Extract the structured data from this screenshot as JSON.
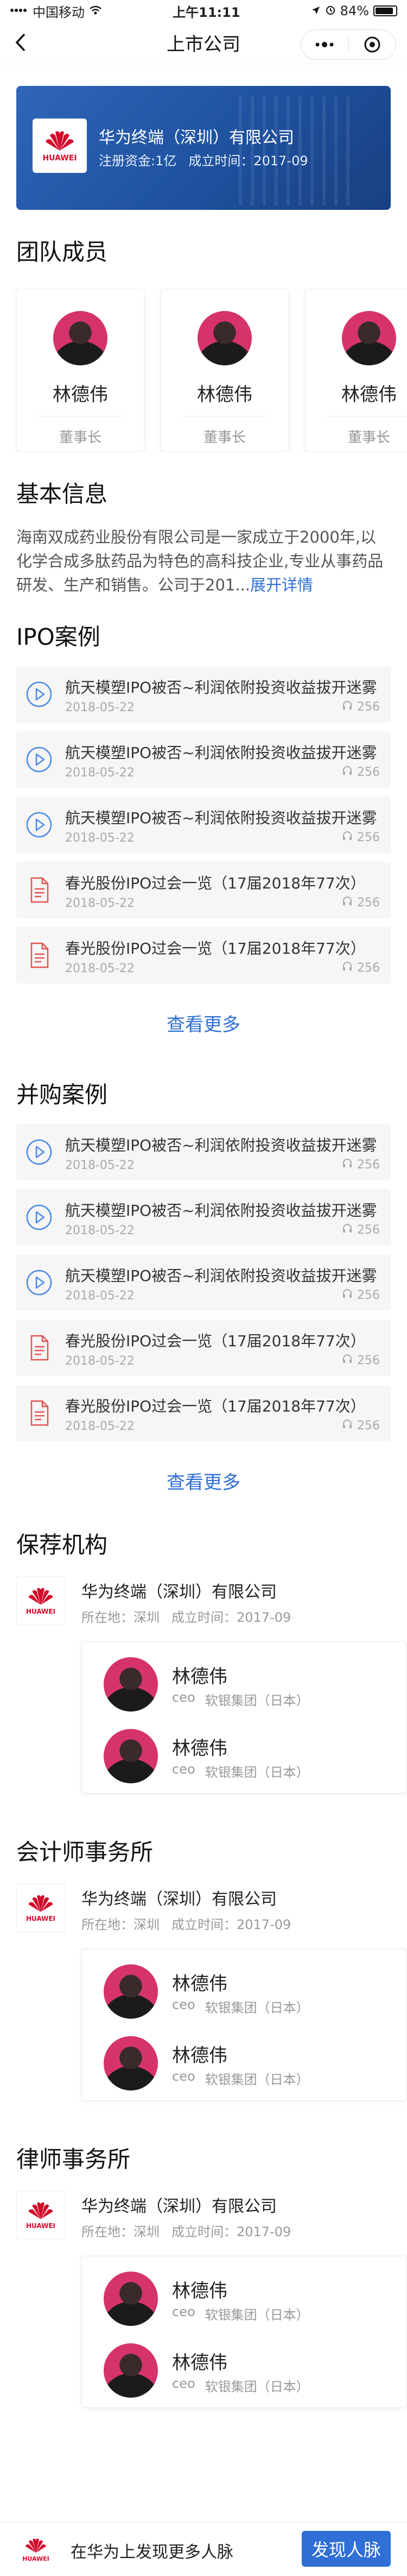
{
  "status_bar": {
    "carrier": "中国移动",
    "time": "上午11:11",
    "battery": "84%"
  },
  "nav": {
    "title": "上市公司"
  },
  "company": {
    "name": "华为终端（深圳）有限公司",
    "capital": "注册资金:1亿",
    "founded": "成立时间：2017-09",
    "logo_text": "HUAWEI"
  },
  "team": {
    "title": "团队成员",
    "members": [
      {
        "name": "林德伟",
        "role": "董事长"
      },
      {
        "name": "林德伟",
        "role": "董事长"
      },
      {
        "name": "林德伟",
        "role": "董事长"
      }
    ]
  },
  "about": {
    "title": "基本信息",
    "text": "海南双成药业股份有限公司是一家成立于2000年,以化学合成多肽药品为特色的高科技企业,专业从事药品研发、生产和销售。公司于201...",
    "more": "展开详情"
  },
  "ipo": {
    "title": "IPO案例",
    "items": [
      {
        "icon": "play-icon",
        "title": "航天模塑IPO被否~利润依附投资收益拔开迷雾",
        "date": "2018-05-22",
        "count": "256"
      },
      {
        "icon": "play-icon",
        "title": "航天模塑IPO被否~利润依附投资收益拔开迷雾",
        "date": "2018-05-22",
        "count": "256"
      },
      {
        "icon": "play-icon",
        "title": "航天模塑IPO被否~利润依附投资收益拔开迷雾",
        "date": "2018-05-22",
        "count": "256"
      },
      {
        "icon": "document-icon",
        "title": "春光股份IPO过会一览（17届2018年77次）",
        "date": "2018-05-22",
        "count": "256"
      },
      {
        "icon": "document-icon",
        "title": "春光股份IPO过会一览（17届2018年77次）",
        "date": "2018-05-22",
        "count": "256"
      }
    ],
    "more": "查看更多"
  },
  "merger": {
    "title": "并购案例",
    "items": [
      {
        "icon": "play-icon",
        "title": "航天模塑IPO被否~利润依附投资收益拔开迷雾",
        "date": "2018-05-22",
        "count": "256"
      },
      {
        "icon": "play-icon",
        "title": "航天模塑IPO被否~利润依附投资收益拔开迷雾",
        "date": "2018-05-22",
        "count": "256"
      },
      {
        "icon": "play-icon",
        "title": "航天模塑IPO被否~利润依附投资收益拔开迷雾",
        "date": "2018-05-22",
        "count": "256"
      },
      {
        "icon": "document-icon",
        "title": "春光股份IPO过会一览（17届2018年77次）",
        "date": "2018-05-22",
        "count": "256"
      },
      {
        "icon": "document-icon",
        "title": "春光股份IPO过会一览（17届2018年77次）",
        "date": "2018-05-22",
        "count": "256"
      }
    ],
    "more": "查看更多"
  },
  "orgs": [
    {
      "title": "保荐机构",
      "name": "华为终端（深圳）有限公司",
      "location": "所在地：深圳",
      "founded": "成立时间：2017-09",
      "people": [
        {
          "name": "林德伟",
          "position": "ceo",
          "company": "软银集团（日本）"
        },
        {
          "name": "林德伟",
          "position": "ceo",
          "company": "软银集团（日本）"
        }
      ]
    },
    {
      "title": "会计师事务所",
      "name": "华为终端（深圳）有限公司",
      "location": "所在地：深圳",
      "founded": "成立时间：2017-09",
      "people": [
        {
          "name": "林德伟",
          "position": "ceo",
          "company": "软银集团（日本）"
        },
        {
          "name": "林德伟",
          "position": "ceo",
          "company": "软银集团（日本）"
        }
      ]
    },
    {
      "title": "律师事务所",
      "name": "华为终端（深圳）有限公司",
      "location": "所在地：深圳",
      "founded": "成立时间：2017-09",
      "people": [
        {
          "name": "林德伟",
          "position": "ceo",
          "company": "软银集团（日本）"
        },
        {
          "name": "林德伟",
          "position": "ceo",
          "company": "软银集团（日本）"
        }
      ]
    }
  ],
  "bottom": {
    "text": "在华为上发现更多人脉",
    "button": "发现人脉"
  },
  "colors": {
    "accent": "#2f6fd6",
    "brand_red": "#d10a2b",
    "banner": "#1d4f9c"
  }
}
